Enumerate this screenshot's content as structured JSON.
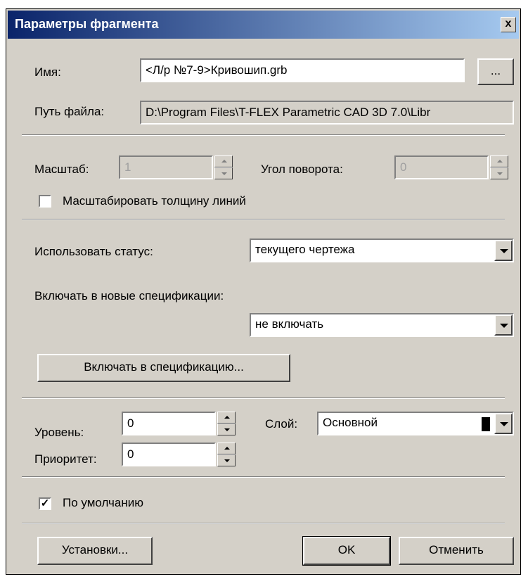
{
  "window": {
    "title": "Параметры фрагмента",
    "close_symbol": "x"
  },
  "name": {
    "label": "Имя:",
    "value": "<Л/р №7-9>Кривошип.grb",
    "browse_label": "..."
  },
  "path": {
    "label": "Путь файла:",
    "value": "D:\\Program Files\\T-FLEX Parametric CAD 3D 7.0\\Libr"
  },
  "scale": {
    "label": "Масштаб:",
    "value": "1"
  },
  "rotation": {
    "label": "Угол поворота:",
    "value": "0"
  },
  "scale_lines": {
    "label": "Масштабировать толщину линий",
    "checked": false,
    "mark": ""
  },
  "status": {
    "label": "Использовать статус:",
    "value": "текущего чертежа"
  },
  "spec": {
    "label": "Включать в новые спецификации:",
    "value": "не включать",
    "button_label": "Включать в спецификацию..."
  },
  "level": {
    "label": "Уровень:",
    "value": "0"
  },
  "layer": {
    "label": "Слой:",
    "value": "Основной",
    "color": "#000000"
  },
  "priority": {
    "label": "Приоритет:",
    "value": "0"
  },
  "default": {
    "label": "По умолчанию",
    "checked": true,
    "mark": "✓"
  },
  "footer": {
    "settings_label": "Установки...",
    "ok_label": "OK",
    "cancel_label": "Отменить"
  }
}
